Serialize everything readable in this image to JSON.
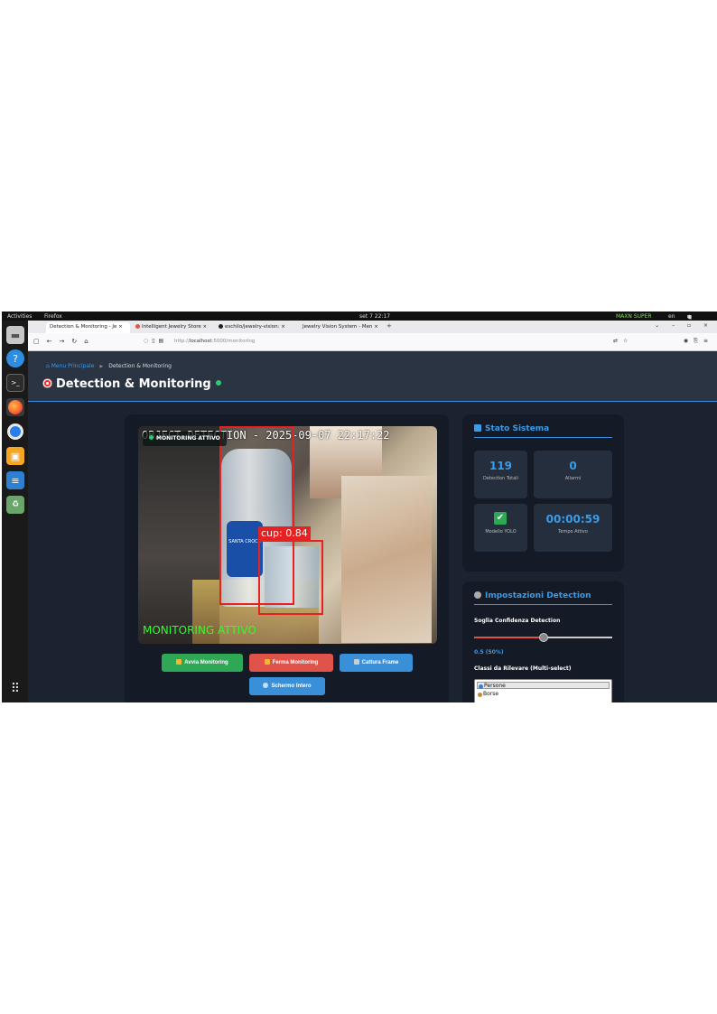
{
  "topbar": {
    "activities": "Activities",
    "app": "Firefox",
    "clock": "set 7 22:17",
    "power_mode": "MAXN SUPER",
    "lang": "en",
    "sys_icons": [
      "wifi-icon",
      "volume-icon",
      "power-icon"
    ]
  },
  "dock": {
    "items": [
      "files-icon",
      "help-icon",
      "terminal-icon",
      "firefox-icon",
      "chromium-icon",
      "software-store-icon",
      "writer-icon",
      "trash-icon"
    ],
    "apps_grid": "show-apps-icon"
  },
  "browser": {
    "tabs": [
      {
        "label": "Detection & Monitoring - Je",
        "active": true
      },
      {
        "label": "Intelligent Jewelry Store",
        "active": false
      },
      {
        "label": "eschilo/jewelry-vision:",
        "active": false
      },
      {
        "label": "Jewelry Vision System - Men",
        "active": false
      }
    ],
    "url_prefix": "http://",
    "url_host": "localhost",
    "url_path": ":5000/monitoring"
  },
  "page": {
    "breadcrumb_home": "Menu Principale",
    "breadcrumb_current": "Detection & Monitoring",
    "title": "Detection & Monitoring",
    "status_dot_color": "#2ecc71"
  },
  "video": {
    "overlay_text": "OBJECT DETECTION - 2025-09-07 22:17:22",
    "status_badge": "MONITORING ATTIVO",
    "detection_label": "cup: 0.84",
    "footer_text": "MONITORING ATTIVO",
    "label_text": "SANTA CROCE",
    "box_color": "#e52121"
  },
  "controls": {
    "start": "Avvia Monitoring",
    "stop": "Ferma Monitoring",
    "capture": "Cattura Frame",
    "fullscreen": "Schermo Intero"
  },
  "stats": {
    "title": "Stato Sistema",
    "detections_value": "119",
    "detections_label": "Detection Totali",
    "alarms_value": "0",
    "alarms_label": "Allarmi",
    "model_label": "Modello YOLO",
    "uptime_value": "00:00:59",
    "uptime_label": "Tempo Attivo"
  },
  "settings": {
    "title": "Impostazioni Detection",
    "threshold_label": "Soglia Confidenza Detection",
    "threshold_fraction": 0.5,
    "threshold_display": "0.5 (50%)",
    "classes_label": "Classi da Rilevare (Multi-select)",
    "classes": [
      {
        "label": "Persone",
        "selected": true
      },
      {
        "label": "Borse",
        "selected": false
      }
    ]
  },
  "colors": {
    "accent": "#3a9be8",
    "success": "#2ea855",
    "danger": "#e0534a"
  }
}
